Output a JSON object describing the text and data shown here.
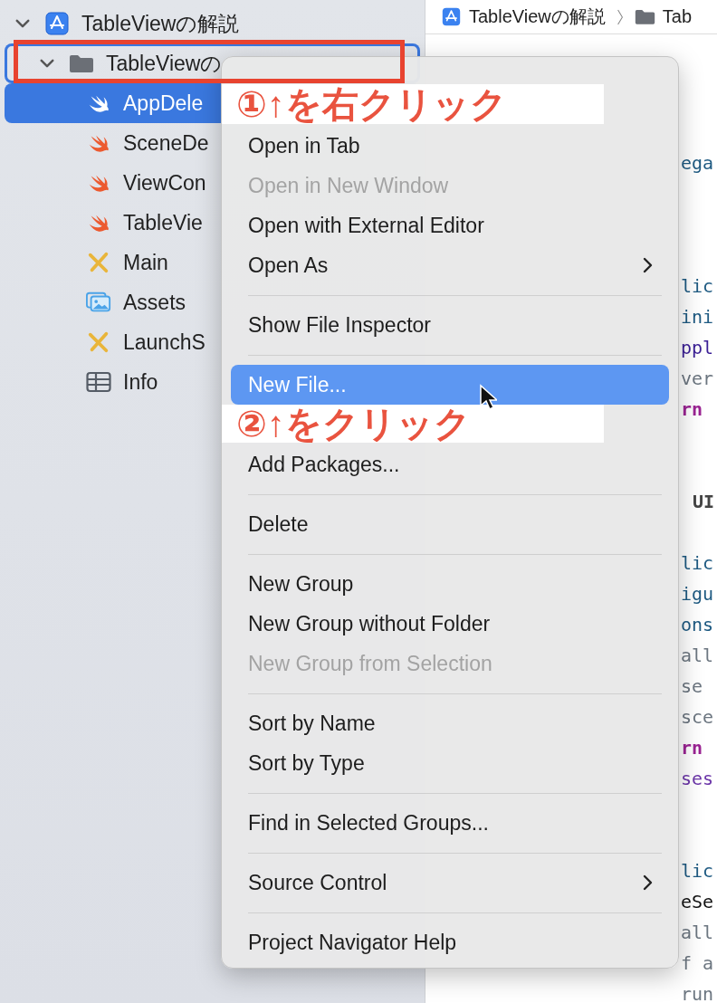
{
  "sidebar": {
    "tree": [
      {
        "name": "TableViewの解説",
        "kind": "project",
        "expanded": true,
        "children": [
          {
            "name": "TableViewの",
            "kind": "folder",
            "expanded": true,
            "focused": true,
            "children": [
              {
                "name": "AppDele",
                "kind": "swift",
                "selected": true
              },
              {
                "name": "SceneDe",
                "kind": "swift",
                "selected": false
              },
              {
                "name": "ViewCon",
                "kind": "swift",
                "selected": false
              },
              {
                "name": "TableVie",
                "kind": "swift",
                "selected": false
              },
              {
                "name": "Main",
                "kind": "storyboard",
                "selected": false
              },
              {
                "name": "Assets",
                "kind": "assets",
                "selected": false
              },
              {
                "name": "LaunchS",
                "kind": "storyboard",
                "selected": false
              },
              {
                "name": "Info",
                "kind": "plist",
                "selected": false
              }
            ]
          }
        ]
      }
    ]
  },
  "breadcrumb": [
    {
      "label": "TableViewの解説",
      "kind": "project"
    },
    {
      "label": "Tab",
      "kind": "folder"
    }
  ],
  "code_lines": [
    {
      "kind": "blank"
    },
    {
      "kind": "blank"
    },
    {
      "kind": "blank"
    },
    {
      "kind": "blank"
    },
    {
      "text": "ega",
      "kind": "name"
    },
    {
      "kind": "blank"
    },
    {
      "kind": "blank"
    },
    {
      "kind": "blank"
    },
    {
      "text": "lic",
      "kind": "name"
    },
    {
      "text": "ini",
      "kind": "name"
    },
    {
      "text": "ppl",
      "kind": "type"
    },
    {
      "text": "ver",
      "kind": "comment"
    },
    {
      "text": "rn",
      "kind": "keyword"
    },
    {
      "kind": "blank"
    },
    {
      "kind": "blank"
    },
    {
      "text": "UI",
      "kind": "heading"
    },
    {
      "kind": "blank"
    },
    {
      "text": "lic",
      "kind": "name"
    },
    {
      "text": "igu",
      "kind": "name"
    },
    {
      "text": "ons",
      "kind": "name"
    },
    {
      "text": "all",
      "kind": "comment"
    },
    {
      "text": "se",
      "kind": "comment"
    },
    {
      "text": "sce",
      "kind": "comment"
    },
    {
      "text": "rn",
      "kind": "keyword"
    },
    {
      "text": "ses",
      "kind": "member"
    },
    {
      "kind": "blank"
    },
    {
      "kind": "blank"
    },
    {
      "text": "lic",
      "kind": "name"
    },
    {
      "text": "eSe",
      "kind": "plain"
    },
    {
      "text": "all",
      "kind": "comment"
    },
    {
      "text": "f a",
      "kind": "comment"
    },
    {
      "text": "run",
      "kind": "comment"
    }
  ],
  "context_menu": {
    "sections": [
      [
        {
          "label": "Open in Tab",
          "disabled": false,
          "submenu": false,
          "selected": false
        },
        {
          "label": "Open in New Window",
          "disabled": true,
          "submenu": false,
          "selected": false
        },
        {
          "label": "Open with External Editor",
          "disabled": false,
          "submenu": false,
          "selected": false
        },
        {
          "label": "Open As",
          "disabled": false,
          "submenu": true,
          "selected": false
        }
      ],
      [
        {
          "label": "Show File Inspector",
          "disabled": false,
          "submenu": false,
          "selected": false
        }
      ],
      [
        {
          "label": "New File...",
          "disabled": false,
          "submenu": false,
          "selected": true
        },
        {
          "label": "Add Packages...",
          "disabled": false,
          "submenu": false,
          "selected": false
        }
      ],
      [
        {
          "label": "Delete",
          "disabled": false,
          "submenu": false,
          "selected": false
        }
      ],
      [
        {
          "label": "New Group",
          "disabled": false,
          "submenu": false,
          "selected": false
        },
        {
          "label": "New Group without Folder",
          "disabled": false,
          "submenu": false,
          "selected": false
        },
        {
          "label": "New Group from Selection",
          "disabled": true,
          "submenu": false,
          "selected": false
        }
      ],
      [
        {
          "label": "Sort by Name",
          "disabled": false,
          "submenu": false,
          "selected": false
        },
        {
          "label": "Sort by Type",
          "disabled": false,
          "submenu": false,
          "selected": false
        }
      ],
      [
        {
          "label": "Find in Selected Groups...",
          "disabled": false,
          "submenu": false,
          "selected": false
        }
      ],
      [
        {
          "label": "Source Control",
          "disabled": false,
          "submenu": true,
          "selected": false
        }
      ],
      [
        {
          "label": "Project Navigator Help",
          "disabled": false,
          "submenu": false,
          "selected": false
        }
      ]
    ]
  },
  "annotations": [
    "①↑を右クリック",
    "②↑をクリック"
  ]
}
